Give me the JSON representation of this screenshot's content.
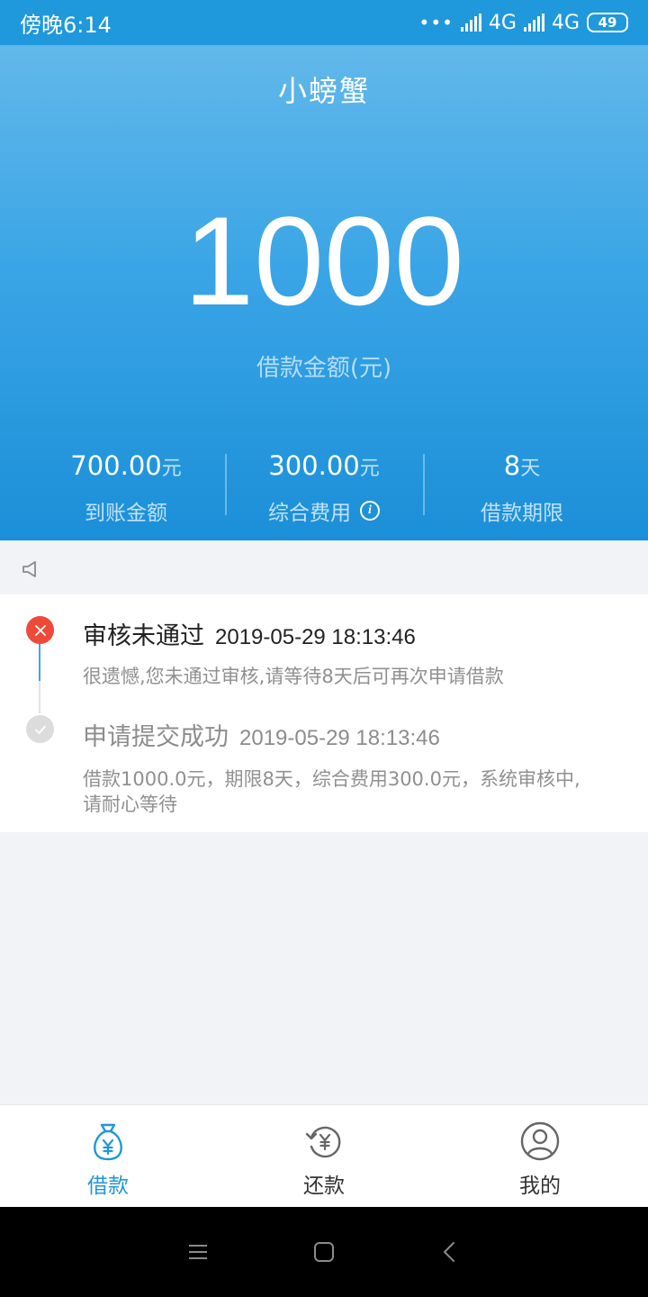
{
  "status_bar": {
    "time": "傍晚6:14",
    "network1": "4G",
    "network2": "4G",
    "battery": "49"
  },
  "app": {
    "title": "小螃蟹"
  },
  "loan": {
    "amount": "1000",
    "amount_label": "借款金额(元)",
    "stats": [
      {
        "value": "700.00",
        "unit": "元",
        "label": "到账金额"
      },
      {
        "value": "300.00",
        "unit": "元",
        "label": "综合费用"
      },
      {
        "value": "8",
        "unit": "天",
        "label": "借款期限"
      }
    ]
  },
  "timeline": [
    {
      "status": "rejected",
      "title": "审核未通过",
      "timestamp": "2019-05-29 18:13:46",
      "description": "很遗憾,您未通过审核,请等待8天后可再次申请借款"
    },
    {
      "status": "submitted",
      "title": "申请提交成功",
      "timestamp": "2019-05-29 18:13:46",
      "description_line1": "借款1000.0元，期限8天，综合费用300.0元，系统审核中,",
      "description_line2": "请耐心等待"
    }
  ],
  "tabs": [
    {
      "label": "借款",
      "icon": "money-bag-icon",
      "active": true
    },
    {
      "label": "还款",
      "icon": "repay-icon",
      "active": false
    },
    {
      "label": "我的",
      "icon": "profile-icon",
      "active": false
    }
  ],
  "colors": {
    "accent": "#2196d8",
    "error": "#ee4a3a",
    "hero_top": "#62b8ea",
    "hero_bottom": "#1b8fd8"
  }
}
